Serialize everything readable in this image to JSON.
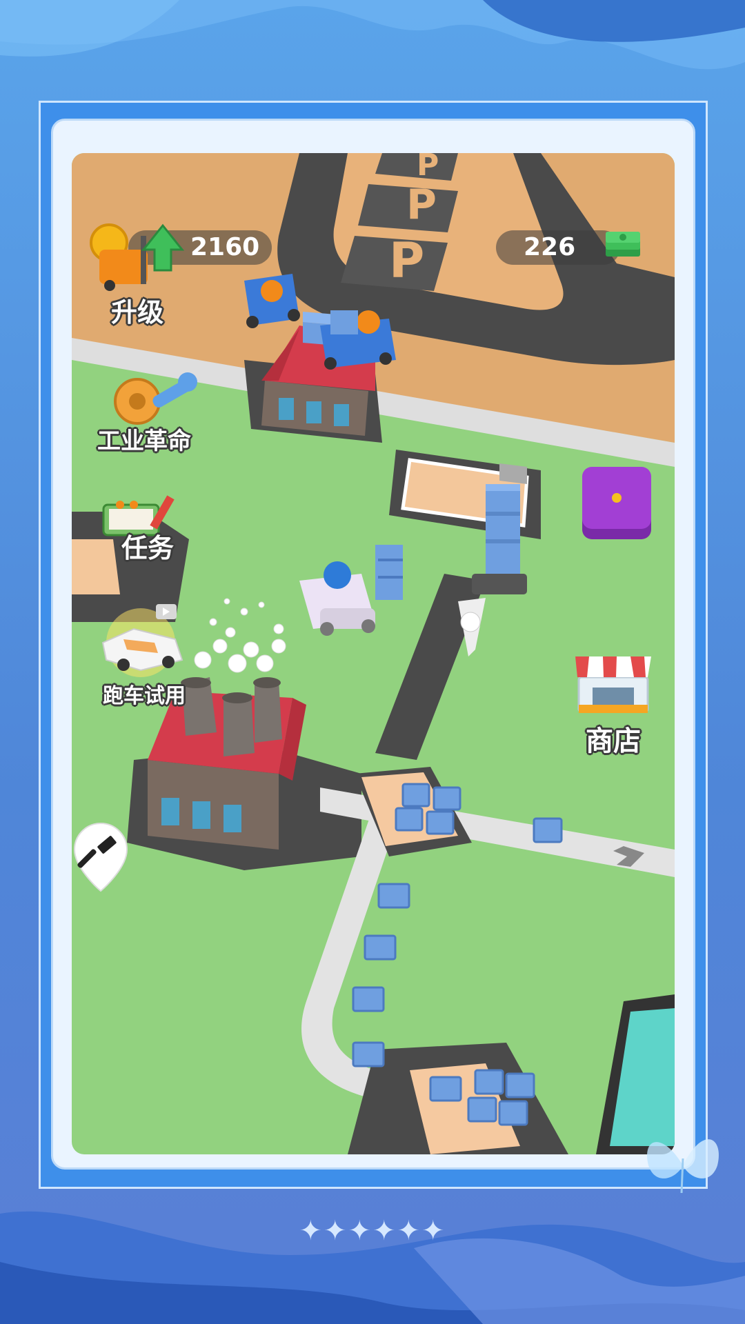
{
  "hud": {
    "coins_value": "2160",
    "cash_value": "226"
  },
  "buttons": {
    "upgrade_label": "升级",
    "industrial_revolution_label": "工业革命",
    "tasks_label": "任务",
    "sports_car_trial_label": "跑车试用",
    "shop_label": "商店"
  },
  "decor": {
    "stars": "✦✦✦✦✦✦"
  },
  "colors": {
    "background": "#4f86d8",
    "frame": "#3e8fea",
    "grass": "#92d27f",
    "road": "#555555",
    "sand": "#e0aa70",
    "roof_red": "#d43c4c",
    "box_blue": "#6f9fe0",
    "cash_green": "#3fbf5a",
    "coin_gold": "#f5b719",
    "pad_purple": "#9b35c9"
  },
  "icons": {
    "coin": "coin-icon",
    "cash": "cash-stack-icon",
    "upgrade": "forklift-upgrade-icon",
    "industrial": "gear-wrench-icon",
    "tasks": "checklist-pencil-icon",
    "car": "sports-car-icon",
    "video": "video-ad-icon",
    "shop": "shop-stall-icon",
    "build": "hammer-icon"
  }
}
